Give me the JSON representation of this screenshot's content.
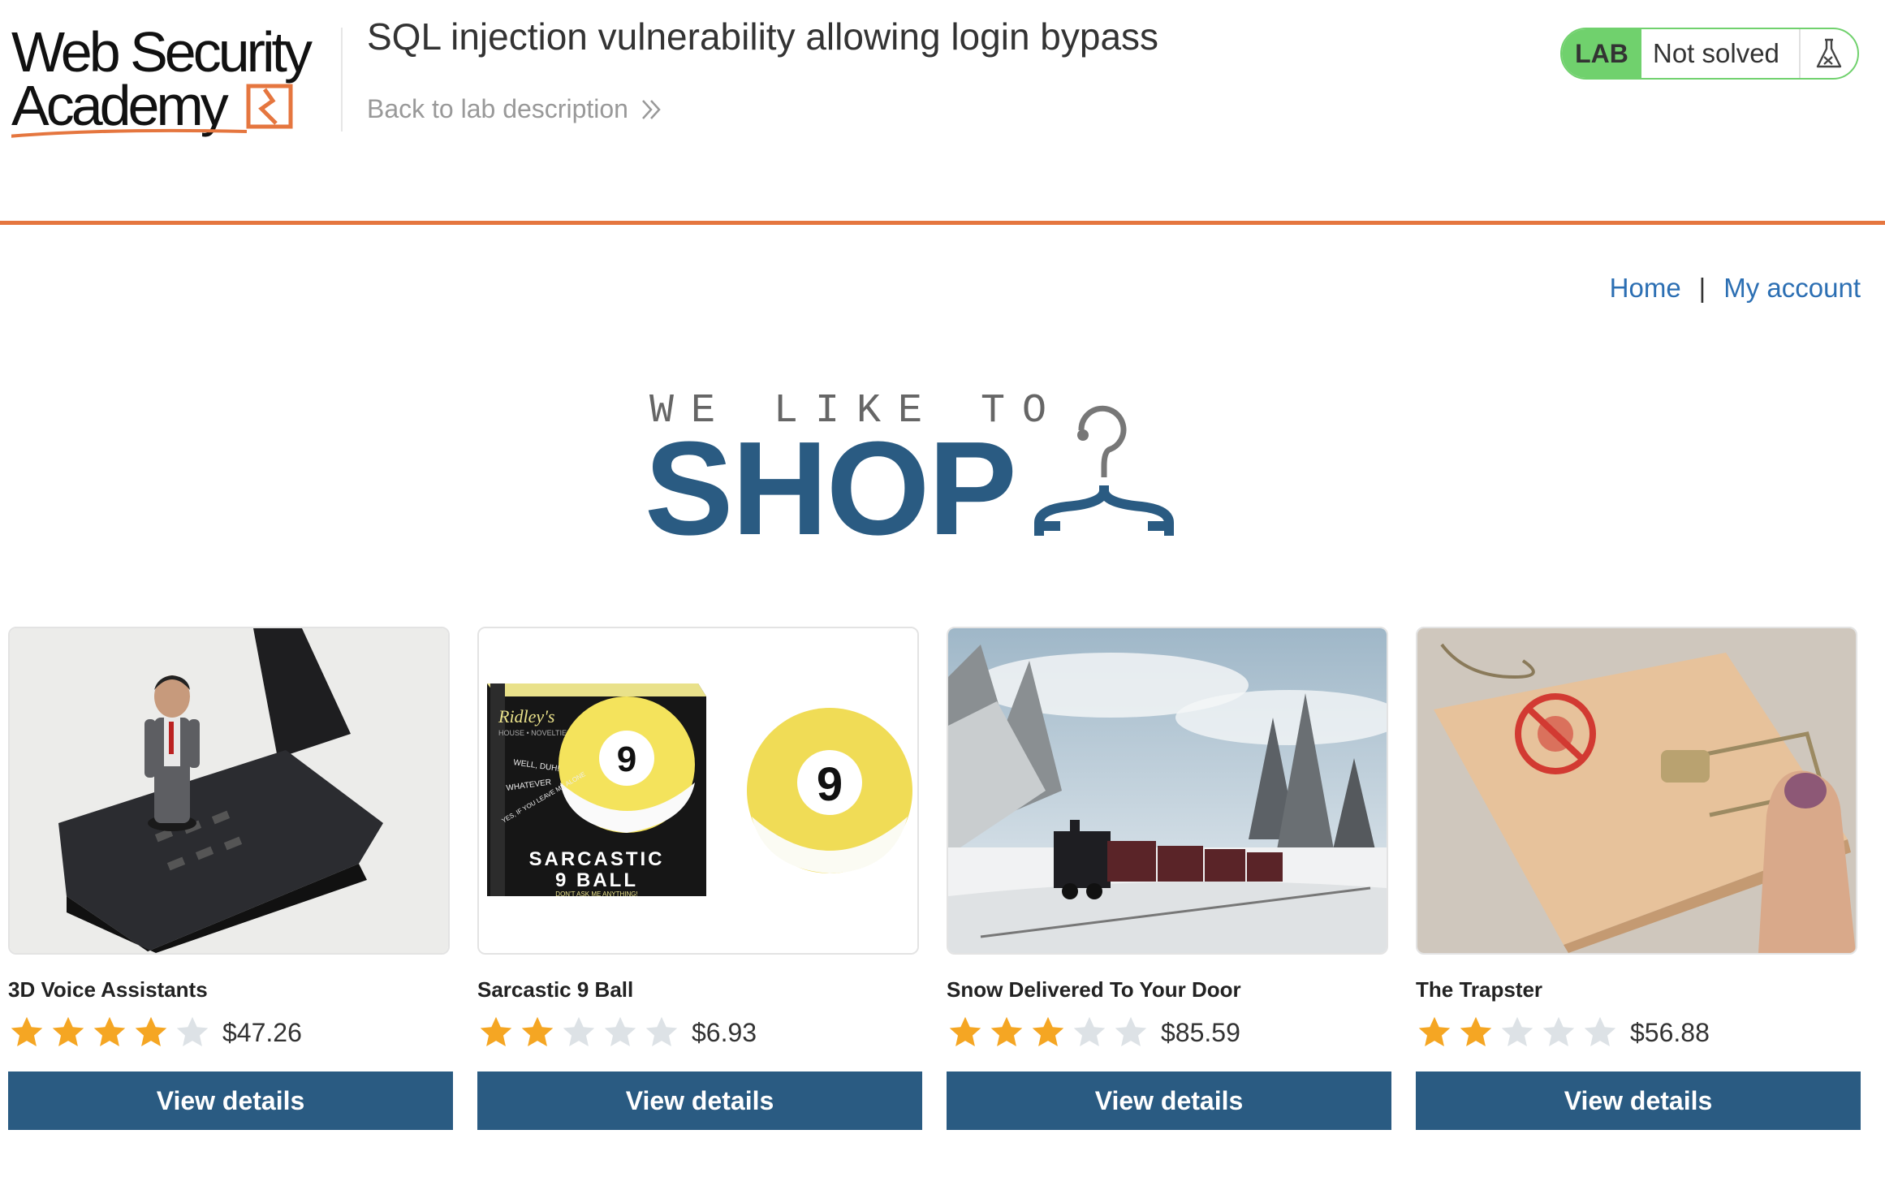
{
  "academy": {
    "logo_line1": "Web Security",
    "logo_line2": "Academy",
    "lab_title": "SQL injection vulnerability allowing login bypass",
    "back_link": "Back to lab description",
    "status_badge": "LAB",
    "status_text": "Not solved",
    "status_icon": "flask-icon",
    "accent_color": "#e5763f",
    "status_color": "#70d16d"
  },
  "nav": {
    "home": "Home",
    "separator": "|",
    "my_account": "My account",
    "link_color": "#2c6fb3"
  },
  "banner": {
    "line1": "WE LIKE TO",
    "line2": "SHOP",
    "icon": "hanger-icon",
    "color": "#2a5b82"
  },
  "products": [
    {
      "name": "3D Voice Assistants",
      "rating": 4,
      "price": "$47.26",
      "button": "View details",
      "image": "figurine-on-flip-phone"
    },
    {
      "name": "Sarcastic 9 Ball",
      "rating": 2,
      "price": "$6.93",
      "button": "View details",
      "image": "sarcastic-9-ball-box",
      "box_text": {
        "brand": "Ridley's",
        "tagline": "HOUSE • NOVELTIES",
        "line1": "WELL, DUH!",
        "line2": "WHATEVER",
        "line3": "YES, IF YOU LEAVE ME ALONE",
        "title1": "SARCASTIC",
        "title2": "9 BALL",
        "foot": "DON'T ASK ME ANYTHING!",
        "ball_number": "9"
      }
    },
    {
      "name": "Snow Delivered To Your Door",
      "rating": 3,
      "price": "$85.59",
      "button": "View details",
      "image": "steam-train-in-snow"
    },
    {
      "name": "The Trapster",
      "rating": 2,
      "price": "$56.88",
      "button": "View details",
      "image": "mousetrap-on-finger"
    }
  ],
  "button_color": "#2a5b82",
  "star_color": "#f5a623"
}
